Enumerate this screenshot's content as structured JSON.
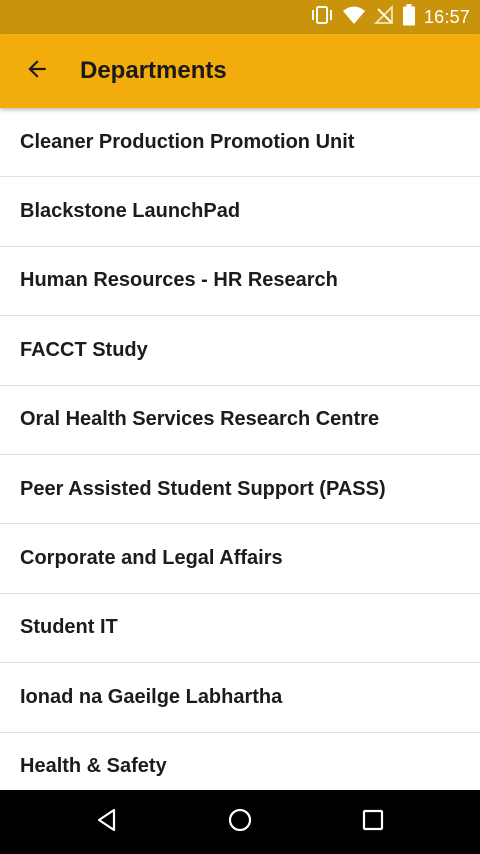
{
  "status_bar": {
    "time": "16:57",
    "icons": [
      "vibrate-icon",
      "wifi-icon",
      "no-signal-icon",
      "battery-icon"
    ]
  },
  "app_bar": {
    "title": "Departments",
    "back_icon": "arrow-back-icon",
    "color": "#F2AC0B",
    "status_color": "#C9940B"
  },
  "departments": [
    "Cleaner Production Promotion Unit",
    "Blackstone LaunchPad",
    "Human Resources - HR Research",
    "FACCT Study",
    "Oral Health Services Research Centre",
    "Peer Assisted Student Support (PASS)",
    "Corporate and Legal Affairs",
    "Student IT",
    "Ionad na Gaeilge Labhartha",
    "Health & Safety"
  ],
  "nav_bar": {
    "buttons": [
      "back-triangle-icon",
      "home-circle-icon",
      "recents-square-icon"
    ]
  }
}
